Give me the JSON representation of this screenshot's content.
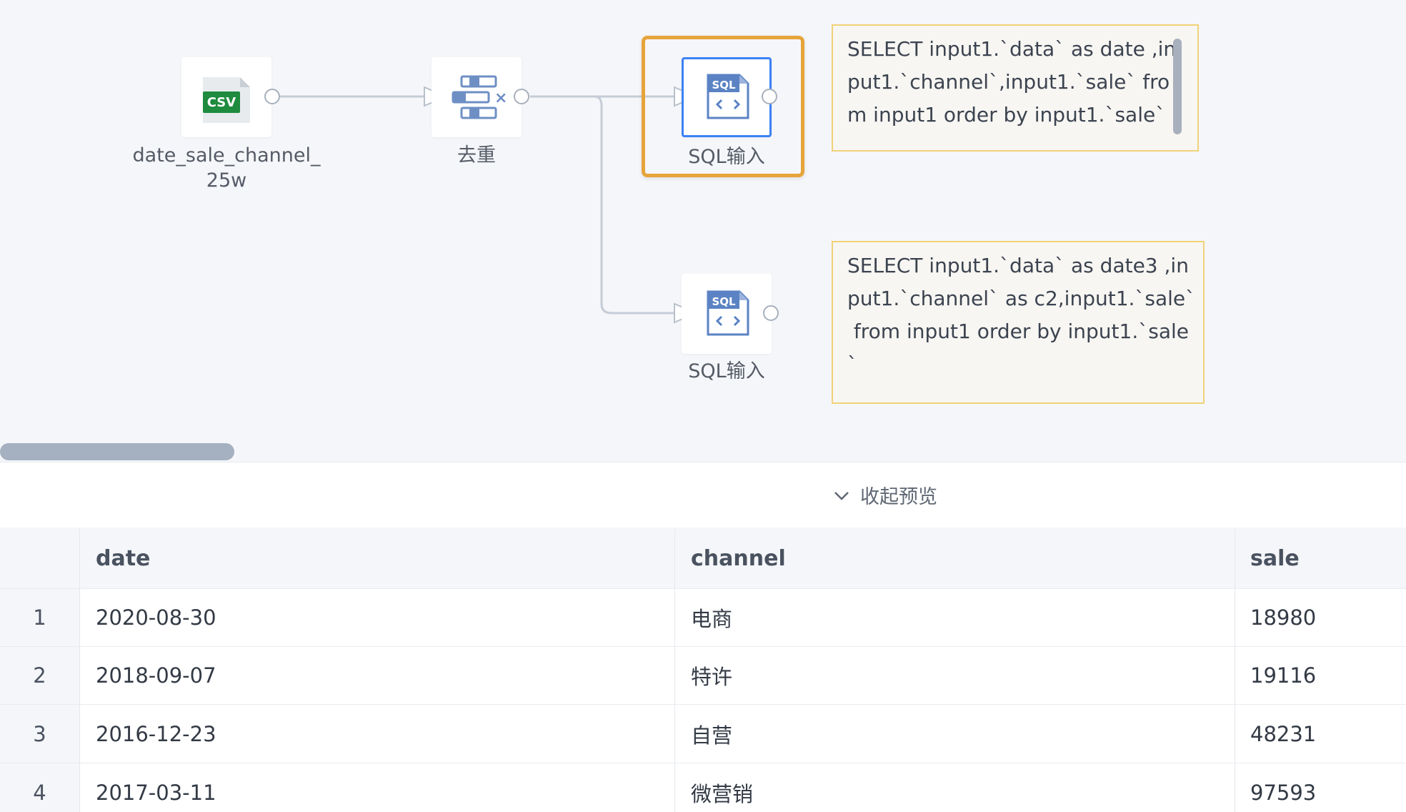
{
  "nodes": {
    "csv_source": {
      "label": "date_sale_channel_\n25w",
      "icon": "csv-file-icon",
      "icon_text": "CSV"
    },
    "dedupe": {
      "label": "去重",
      "icon": "dedupe-icon"
    },
    "sql_1": {
      "label": "SQL输入",
      "icon": "sql-file-icon",
      "icon_text": "SQL"
    },
    "sql_2": {
      "label": "SQL输入",
      "icon": "sql-file-icon",
      "icon_text": "SQL"
    }
  },
  "notes": {
    "sql_1_query": "SELECT input1.`data` as date ,in\nput1.`channel`,input1.`sale` fro\nm input1 order by input1.`sale`",
    "sql_2_query": "SELECT input1.`data` as date3 ,in\nput1.`channel` as c2,input1.`sale`\n from input1 order by input1.`sale\n`"
  },
  "preview": {
    "toggle_label": "收起预览"
  },
  "table": {
    "columns": [
      "date",
      "channel",
      "sale"
    ],
    "rows": [
      {
        "index": "1",
        "date": "2020-08-30",
        "channel": "电商",
        "sale": "18980"
      },
      {
        "index": "2",
        "date": "2018-09-07",
        "channel": "特许",
        "sale": "19116"
      },
      {
        "index": "3",
        "date": "2016-12-23",
        "channel": "自营",
        "sale": "48231"
      },
      {
        "index": "4",
        "date": "2017-03-11",
        "channel": "微营销",
        "sale": "97593"
      }
    ]
  },
  "colors": {
    "selection": "#e6a43a",
    "node_selected_border": "#3b82f6",
    "csv_green": "#1e8b3e",
    "sql_blue": "#5b83c4",
    "note_border": "#f1d27a"
  }
}
